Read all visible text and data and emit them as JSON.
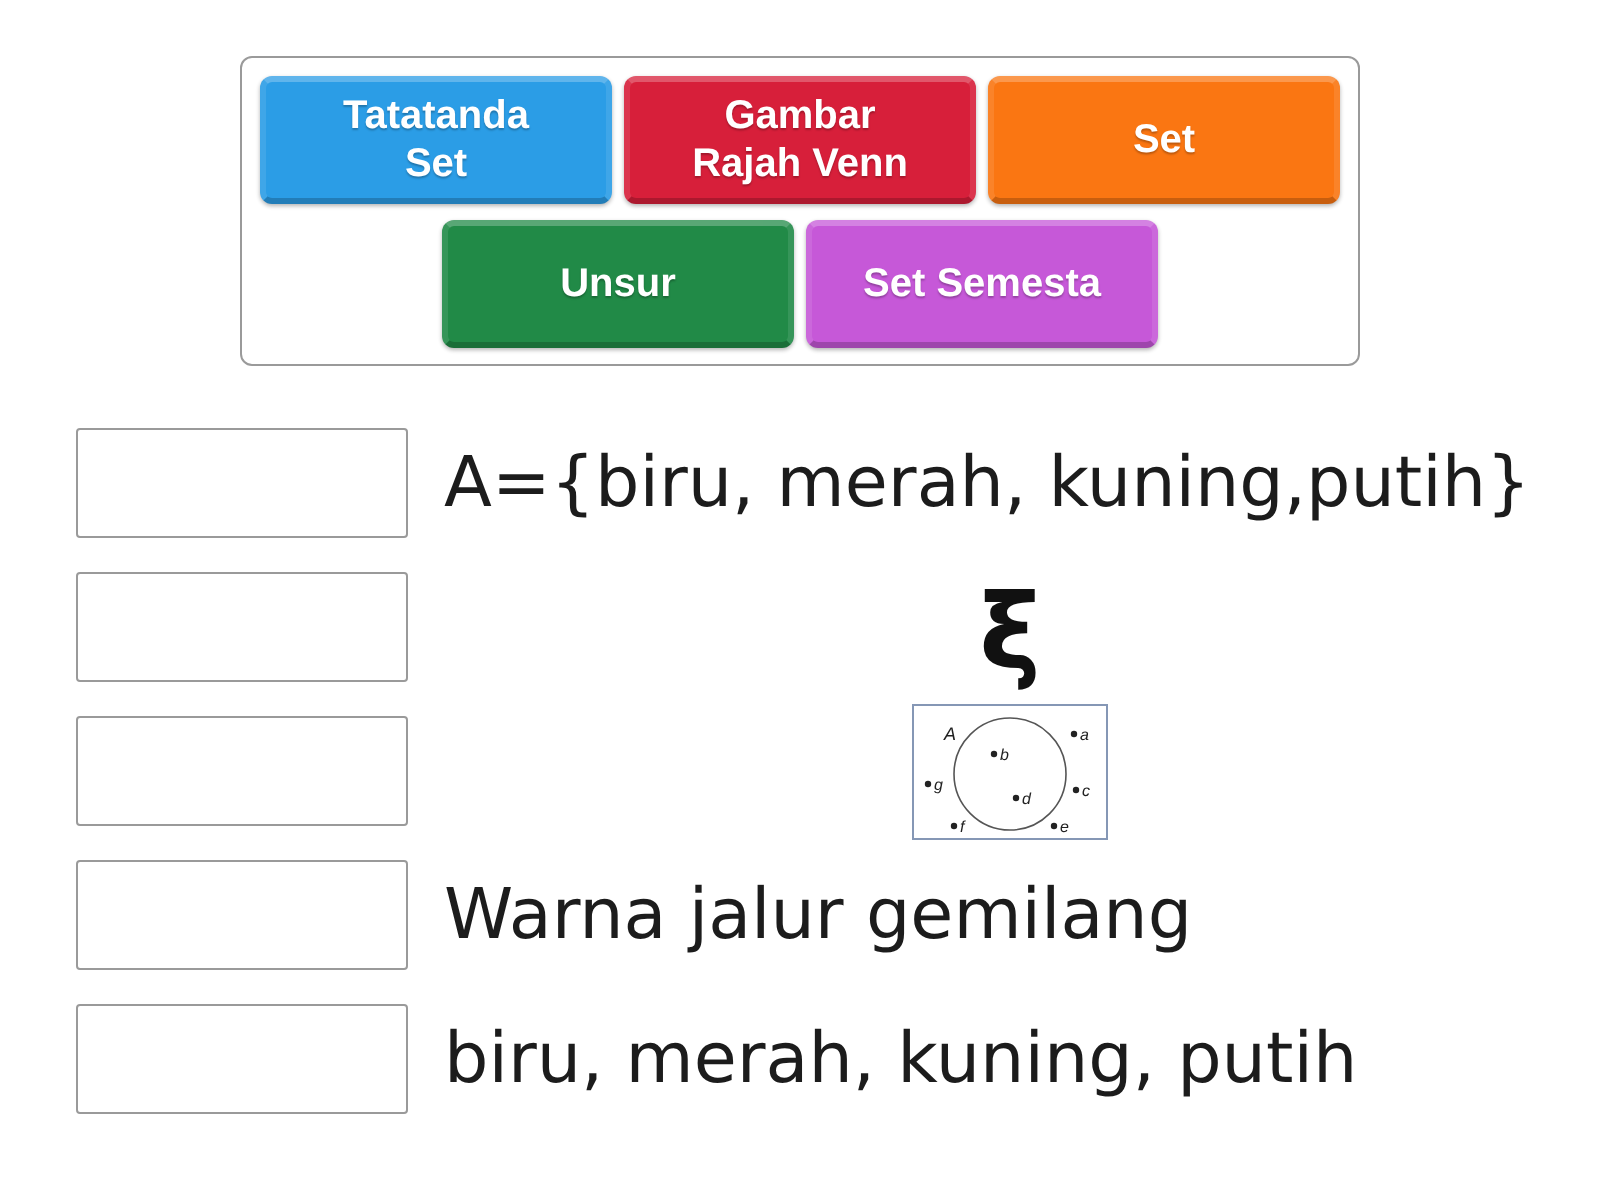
{
  "tiles": [
    {
      "label": "Tatatanda Set",
      "color": "#2b9de6"
    },
    {
      "label": "Gambar Rajah Venn",
      "color": "#d71f3a"
    },
    {
      "label": "Set",
      "color": "#fa7612"
    },
    {
      "label": "Unsur",
      "color": "#218a47"
    },
    {
      "label": "Set Semesta",
      "color": "#c658d8"
    }
  ],
  "rows": [
    {
      "kind": "text",
      "text": "A={biru, merah, kuning,putih}"
    },
    {
      "kind": "symbol",
      "text": "ξ"
    },
    {
      "kind": "venn",
      "set_label": "A",
      "inside": [
        "b",
        "d"
      ],
      "outside": [
        "a",
        "g",
        "c",
        "f",
        "e"
      ]
    },
    {
      "kind": "text",
      "text": "Warna jalur gemilang"
    },
    {
      "kind": "text",
      "text": "biru, merah, kuning, putih"
    }
  ]
}
